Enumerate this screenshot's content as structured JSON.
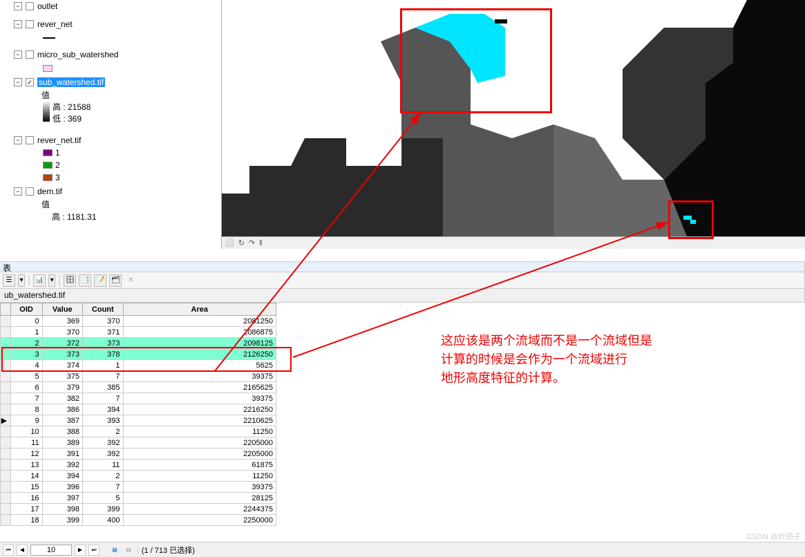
{
  "toc": {
    "items": [
      {
        "indent": 20,
        "exp": "−",
        "chk": "",
        "label": "outlet"
      },
      {
        "indent": 20,
        "exp": "−",
        "chk": "",
        "label": "rever_net"
      },
      {
        "indent": 20,
        "exp": "−",
        "chk": "",
        "label": "micro_sub_watershed"
      },
      {
        "indent": 20,
        "exp": "−",
        "chk": "✓",
        "label": "sub_watershed.tif",
        "selected": true
      },
      {
        "indent": 60,
        "label": "值"
      },
      {
        "indent": 75,
        "label": "高 : 21588"
      },
      {
        "indent": 75,
        "label": "低 : 369"
      },
      {
        "indent": 20,
        "exp": "−",
        "chk": "",
        "label": "rever_net.tif"
      },
      {
        "indent": 62,
        "color": "#800080",
        "label": "1"
      },
      {
        "indent": 62,
        "color": "#00a000",
        "label": "2"
      },
      {
        "indent": 62,
        "color": "#c04000",
        "label": "3"
      },
      {
        "indent": 20,
        "exp": "−",
        "chk": "",
        "label": "dem.tif"
      },
      {
        "indent": 60,
        "label": "值"
      },
      {
        "indent": 75,
        "label": "高 : 1181.31"
      }
    ]
  },
  "map_toolbar": [
    "⬜",
    "↻",
    "↷",
    "‖"
  ],
  "table": {
    "caption_char": "表",
    "toolbar_icons": [
      "☰",
      "▾",
      "|",
      "📊",
      "▾",
      "|",
      "🗄",
      "📑",
      "📝",
      "🗂",
      "✕"
    ],
    "tab": "ub_watershed.tif",
    "columns": [
      "OID",
      "Value",
      "Count",
      "Area"
    ],
    "rows": [
      {
        "oid": 0,
        "v": 369,
        "c": 370,
        "a": 2081250
      },
      {
        "oid": 1,
        "v": 370,
        "c": 371,
        "a": 2086875
      },
      {
        "oid": 2,
        "v": 372,
        "c": 373,
        "a": 2098125,
        "hl": true
      },
      {
        "oid": 3,
        "v": 373,
        "c": 378,
        "a": 2126250,
        "hl": true
      },
      {
        "oid": 4,
        "v": 374,
        "c": 1,
        "a": 5625
      },
      {
        "oid": 5,
        "v": 375,
        "c": 7,
        "a": 39375
      },
      {
        "oid": 6,
        "v": 379,
        "c": 385,
        "a": 2165625
      },
      {
        "oid": 7,
        "v": 382,
        "c": 7,
        "a": 39375
      },
      {
        "oid": 8,
        "v": 386,
        "c": 394,
        "a": 2216250
      },
      {
        "oid": 9,
        "v": 387,
        "c": 393,
        "a": 2210625
      },
      {
        "oid": 10,
        "v": 388,
        "c": 2,
        "a": 11250
      },
      {
        "oid": 11,
        "v": 389,
        "c": 392,
        "a": 2205000
      },
      {
        "oid": 12,
        "v": 391,
        "c": 392,
        "a": 2205000
      },
      {
        "oid": 13,
        "v": 392,
        "c": 11,
        "a": 61875
      },
      {
        "oid": 14,
        "v": 394,
        "c": 2,
        "a": 11250
      },
      {
        "oid": 15,
        "v": 396,
        "c": 7,
        "a": 39375
      },
      {
        "oid": 16,
        "v": 397,
        "c": 5,
        "a": 28125
      },
      {
        "oid": 17,
        "v": 398,
        "c": 399,
        "a": 2244375
      },
      {
        "oid": 18,
        "v": 399,
        "c": 400,
        "a": 2250000
      }
    ],
    "pager": {
      "first": "⏮",
      "prev": "◀",
      "value": "10",
      "next": "▶",
      "last": "⏭",
      "status": "(1 / 713 已选择)",
      "icons": [
        "▤",
        "▭"
      ]
    }
  },
  "annotation": {
    "line1": "这应该是两个流域而不是一个流域但是",
    "line2": "计算的时候是会作为一个流域进行",
    "line3": "地形高度特征的计算。"
  },
  "watermark": "CSDN @炒茄子"
}
